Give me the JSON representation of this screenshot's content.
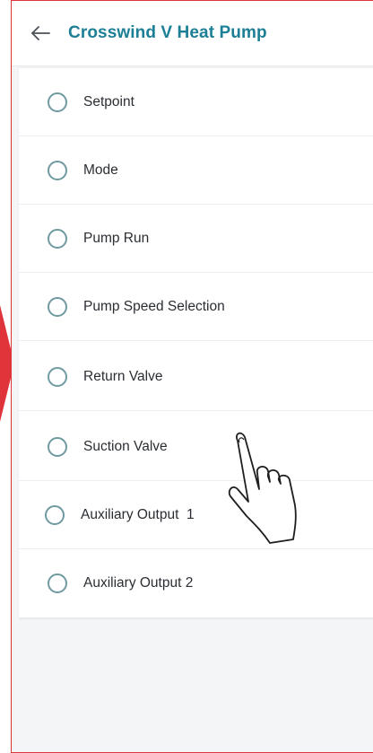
{
  "header": {
    "back_icon": "arrow-left-icon",
    "title": "Crosswind V Heat Pump"
  },
  "list": {
    "items": [
      {
        "label": "Setpoint",
        "selected": false
      },
      {
        "label": "Mode",
        "selected": false
      },
      {
        "label": "Pump Run",
        "selected": false
      },
      {
        "label": "Pump Speed Selection",
        "selected": false
      },
      {
        "label": "Return Valve",
        "selected": false
      },
      {
        "label": "Suction Valve",
        "selected": false
      },
      {
        "label": "Auxiliary Output  1",
        "selected": false
      },
      {
        "label": "Auxiliary Output 2",
        "selected": false
      }
    ]
  },
  "annotations": {
    "callout_arrow_icon": "red-arrow-pointer-icon",
    "hand_icon": "pointing-hand-icon"
  },
  "colors": {
    "title": "#1d7f95",
    "radio_border": "#6f9aa1",
    "annotation_red": "#e0343b",
    "background": "#f4f5f7"
  }
}
